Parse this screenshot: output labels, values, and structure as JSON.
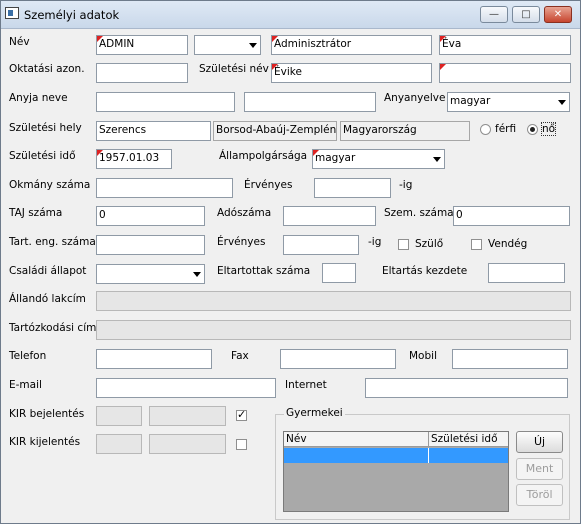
{
  "window": {
    "title": "Személyi adatok"
  },
  "labels": {
    "nev": "Név",
    "oktatasi": "Oktatási azon.",
    "szuletesi_nev": "Születési név",
    "anyja_neve": "Anyja neve",
    "anyanyelve": "Anyanyelve",
    "szuletesi_hely": "Születési hely",
    "ferfi": "férfi",
    "no": "nő",
    "szuletesi_ido": "Születési idő",
    "allampolgarsaga": "Állampolgársága",
    "okmany": "Okmány száma",
    "ervenyes1": "Érvényes",
    "ig1": "-ig",
    "taj": "TAJ száma",
    "adoszama": "Adószáma",
    "szem_szama": "Szem. száma",
    "tart_eng": "Tart. eng. száma",
    "ervenyes2": "Érvényes",
    "ig2": "-ig",
    "szulo": "Szülő",
    "vendeg": "Vendég",
    "csaladi": "Családi állapot",
    "eltartottak": "Eltartottak száma",
    "eltartas_kezdete": "Eltartás kezdete",
    "allando": "Állandó lakcím",
    "tartozkodasi": "Tartózkodási cím",
    "telefon": "Telefon",
    "fax": "Fax",
    "mobil": "Mobil",
    "email": "E-mail",
    "internet": "Internet",
    "kir_bej": "KIR bejelentés",
    "kir_kij": "KIR kijelentés",
    "gyermekei": "Gyermekei"
  },
  "values": {
    "nev_elotag": "ADMIN",
    "nev_csaladi": "Adminisztrátor",
    "nev_uto": "Éva",
    "szuletesi_nev_csaladi": "Évike",
    "anyanyelve": "magyar",
    "szul_hely_varos": "Szerencs",
    "szul_hely_megye": "Borsod-Abaúj-Zemplén",
    "szul_hely_orszag": "Magyarország",
    "szul_ido": "1957.01.03",
    "allampolgarsag": "magyar",
    "taj": "0",
    "szem_szama": "0"
  },
  "state": {
    "gender": "nő",
    "kir_bejelentes_checked": true,
    "kir_kijelentes_checked": false,
    "szulo": false,
    "vendeg": false
  },
  "children_table": {
    "columns": [
      "Név",
      "Születési idő"
    ]
  },
  "buttons": {
    "uj": "Új",
    "ment": "Ment",
    "torol": "Töröl"
  },
  "window_buttons": {
    "minimize": "—",
    "maximize": "□",
    "close": "✕"
  }
}
